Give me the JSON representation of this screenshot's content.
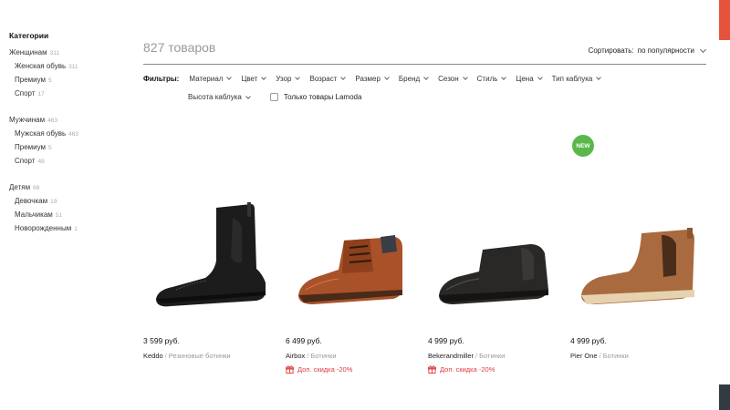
{
  "sidebar": {
    "title": "Категории",
    "groups": [
      {
        "label": "Женщинам",
        "count": "311",
        "items": [
          {
            "label": "Женская обувь",
            "count": "311"
          },
          {
            "label": "Премиум",
            "count": "5"
          },
          {
            "label": "Спорт",
            "count": "17"
          }
        ]
      },
      {
        "label": "Мужчинам",
        "count": "463",
        "items": [
          {
            "label": "Мужская обувь",
            "count": "463"
          },
          {
            "label": "Премиум",
            "count": "5"
          },
          {
            "label": "Спорт",
            "count": "48"
          }
        ]
      },
      {
        "label": "Детям",
        "count": "68",
        "items": [
          {
            "label": "Девочкам",
            "count": "19"
          },
          {
            "label": "Мальчикам",
            "count": "51"
          },
          {
            "label": "Новорожденным",
            "count": "1"
          }
        ]
      }
    ]
  },
  "header": {
    "results_count": "827 товаров",
    "sort_label": "Сортировать:",
    "sort_value": "по популярности"
  },
  "filters": {
    "label": "Фильтры:",
    "items": [
      "Материал",
      "Цвет",
      "Узор",
      "Возраст",
      "Размер",
      "Бренд",
      "Сезон",
      "Стиль",
      "Цена",
      "Тип каблука"
    ],
    "row2_item": "Высота каблука",
    "checkbox_label": "Только товары Lamoda"
  },
  "products": [
    {
      "price": "3 599 руб.",
      "brand": "Keddo",
      "type": "Резиновые ботинки",
      "promo": ""
    },
    {
      "price": "6 499 руб.",
      "brand": "Airbox",
      "type": "Ботинки",
      "promo": "Доп. скидка -20%"
    },
    {
      "price": "4 999 руб.",
      "brand": "Bekerandmiller",
      "type": "Ботинки",
      "promo": "Доп. скидка -20%"
    },
    {
      "price": "4 999 руб.",
      "brand": "Pier One",
      "type": "Ботинки",
      "promo": ""
    }
  ],
  "badge": {
    "new_label": "NEW",
    "color": "#5ab84b"
  },
  "colors": {
    "accent": "#e5533d",
    "promo": "#e03a3e"
  }
}
